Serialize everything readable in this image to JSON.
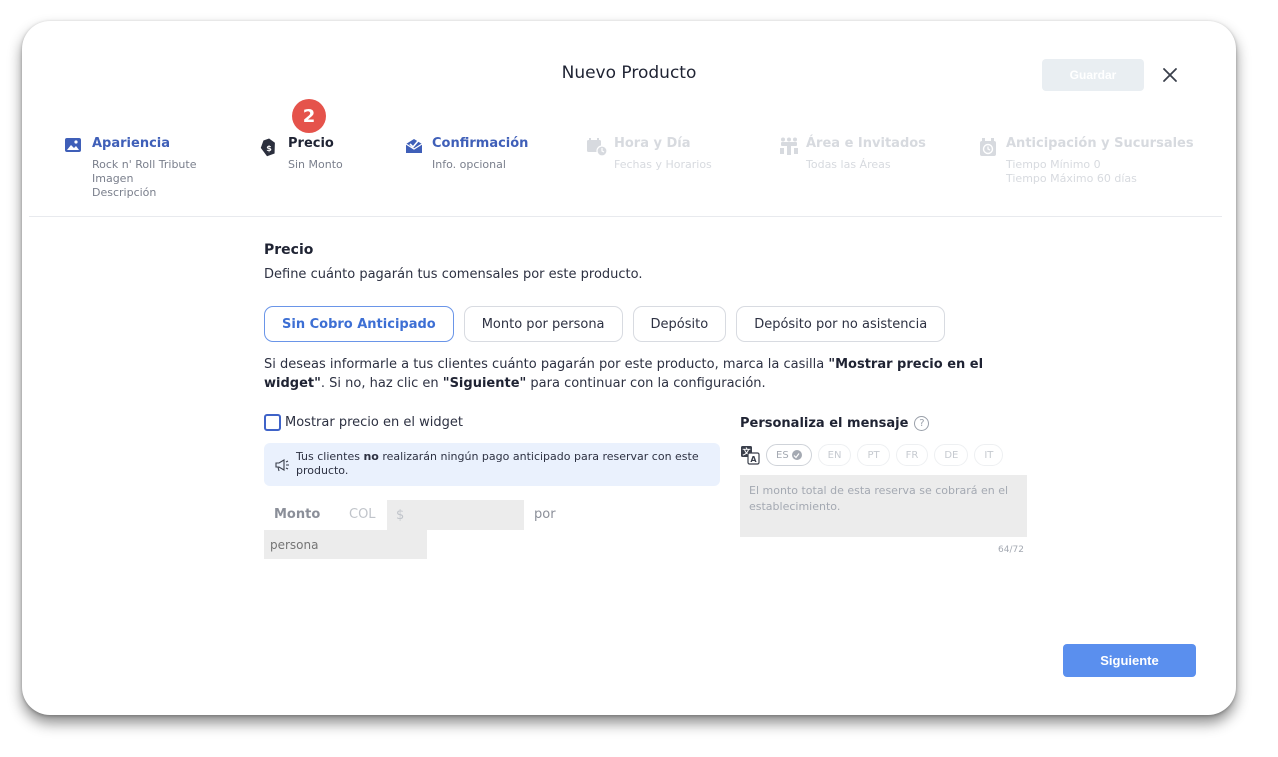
{
  "header": {
    "title": "Nuevo Producto",
    "save_label": "Guardar",
    "close_icon": "close-icon"
  },
  "stepper": {
    "current_step_number": "2",
    "steps": [
      {
        "label": "Apariencia",
        "sub": [
          "Rock n' Roll Tribute",
          "Imagen",
          "Descripción"
        ],
        "icon": "image-icon",
        "state": "done"
      },
      {
        "label": "Precio",
        "sub": [
          "Sin Monto"
        ],
        "icon": "price-tag-icon",
        "state": "current"
      },
      {
        "label": "Confirmación",
        "sub": [
          "Info. opcional"
        ],
        "icon": "confirmation-mail-icon",
        "state": "done"
      },
      {
        "label": "Hora y Día",
        "sub": [
          "Fechas y Horarios"
        ],
        "icon": "calendar-clock-icon",
        "state": "pending"
      },
      {
        "label": "Área e Invitados",
        "sub": [
          "Todas las Áreas"
        ],
        "icon": "table-guests-icon",
        "state": "pending"
      },
      {
        "label": "Anticipación y Sucursales",
        "sub": [
          "Tiempo Mínimo 0",
          "Tiempo Máximo 60 días"
        ],
        "icon": "alarm-clock-icon",
        "state": "pending"
      }
    ]
  },
  "price": {
    "title": "Precio",
    "description": "Define cuánto pagarán tus comensales por este producto.",
    "tabs": [
      {
        "label": "Sin Cobro Anticipado",
        "selected": true
      },
      {
        "label": "Monto por persona",
        "selected": false
      },
      {
        "label": "Depósito",
        "selected": false
      },
      {
        "label": "Depósito por no asistencia",
        "selected": false
      }
    ],
    "info": {
      "part1": "Si deseas informarle a tus clientes cuánto pagarán por este producto, marca la casilla ",
      "bold1": "\"Mostrar precio en el widget\"",
      "part2": ". Si no, haz clic en ",
      "bold2": "\"Siguiente\"",
      "part3": " para continuar con la configuración."
    },
    "show_price_label": "Mostrar precio en el widget",
    "notice": {
      "part1": "Tus clientes ",
      "bold": "no",
      "part2": " realizarán ningún pago anticipado para reservar con este producto."
    },
    "amount_label": "Monto",
    "currency": "COL",
    "currency_symbol": "$",
    "amount_value": "",
    "per_label": "por",
    "unit_placeholder": "persona"
  },
  "message": {
    "title": "Personaliza el mensaje",
    "help": "?",
    "languages": [
      {
        "code": "ES",
        "selected": true
      },
      {
        "code": "EN",
        "selected": false
      },
      {
        "code": "PT",
        "selected": false
      },
      {
        "code": "FR",
        "selected": false
      },
      {
        "code": "DE",
        "selected": false
      },
      {
        "code": "IT",
        "selected": false
      }
    ],
    "text": "El monto total de esta reserva se cobrará en el establecimiento.",
    "counter": "64/72"
  },
  "footer": {
    "next_label": "Siguiente"
  },
  "colors": {
    "accent": "#3f5fb8",
    "primary_button": "#5a8fee",
    "badge": "#e5534b",
    "notice_bg": "#eaf1fd"
  }
}
